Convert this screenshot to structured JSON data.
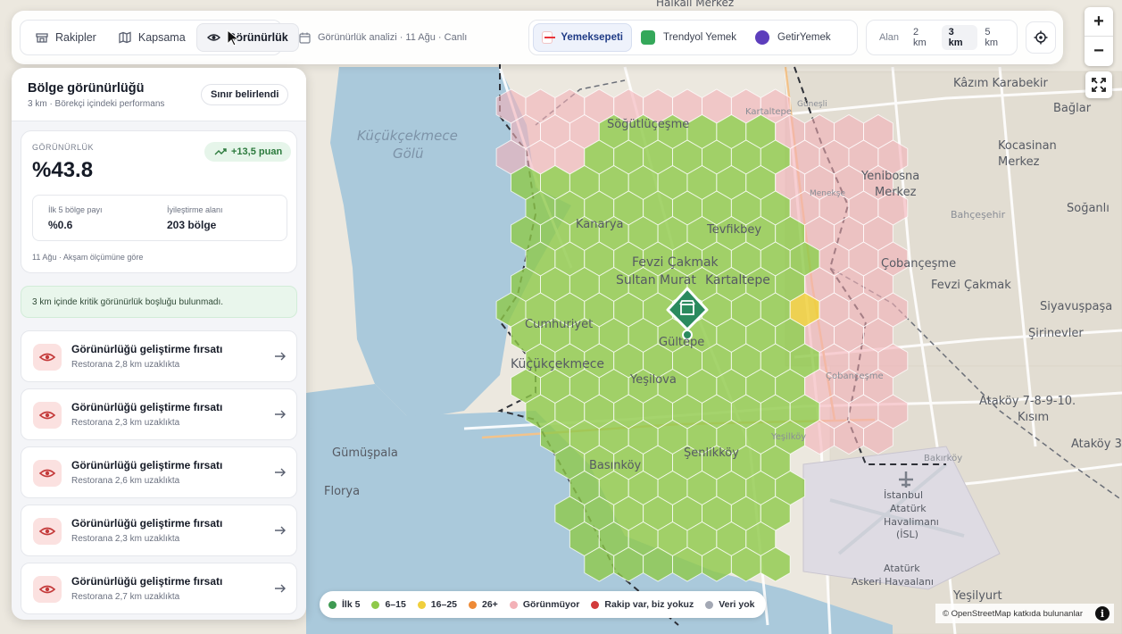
{
  "nav": {
    "tabs": [
      {
        "label": "Rakipler",
        "icon": "store-icon",
        "active": false
      },
      {
        "label": "Kapsama",
        "icon": "map-icon",
        "active": false
      },
      {
        "label": "Görünürlük",
        "icon": "eye-icon",
        "active": true
      }
    ],
    "meta_text": "Görünürlük analizi · 11 Ağu · Canlı",
    "platforms": [
      {
        "label": "Yemeksepeti",
        "color": "#e8353b",
        "active": true
      },
      {
        "label": "Trendyol Yemek",
        "color": "#35a85a",
        "active": false
      },
      {
        "label": "GetirYemek",
        "color": "#5d3ebc",
        "active": false
      }
    ],
    "area_label": "Alan",
    "distances": [
      "2 km",
      "3 km",
      "5 km"
    ],
    "active_distance": "3 km"
  },
  "zoom": {
    "in": "+",
    "out": "−"
  },
  "panel": {
    "title": "Bölge görünürlüğü",
    "subtitle": "3 km · Börekçi içindeki performans",
    "border_button": "Sınır belirlendi",
    "kpi_label": "GÖRÜNÜRLÜK",
    "kpi_value": "%43.8",
    "kpi_delta": "+13,5 puan",
    "stat1_label": "İlk 5 bölge payı",
    "stat1_value": "%0.6",
    "stat2_label": "İyileştirme alanı",
    "stat2_value": "203 bölge",
    "card_footer": "11 Ağu · Akşam ölçümüne göre",
    "notice": "3 km içinde kritik görünürlük boşluğu bulunmadı.",
    "opportunities": [
      {
        "title": "Görünürlüğü geliştirme fırsatı",
        "subtitle": "Restorana 2,8 km uzaklıkta"
      },
      {
        "title": "Görünürlüğü geliştirme fırsatı",
        "subtitle": "Restorana 2,3 km uzaklıkta"
      },
      {
        "title": "Görünürlüğü geliştirme fırsatı",
        "subtitle": "Restorana 2,6 km uzaklıkta"
      },
      {
        "title": "Görünürlüğü geliştirme fırsatı",
        "subtitle": "Restorana 2,3 km uzaklıkta"
      },
      {
        "title": "Görünürlüğü geliştirme fırsatı",
        "subtitle": "Restorana 2,7 km uzaklıkta"
      }
    ]
  },
  "legend": [
    {
      "label": "İlk 5",
      "color": "#3f9a52"
    },
    {
      "label": "6–15",
      "color": "#8fc94a"
    },
    {
      "label": "16–25",
      "color": "#f0cf3c"
    },
    {
      "label": "26+",
      "color": "#ee8a36"
    },
    {
      "label": "Görünmüyor",
      "color": "#f3b1b7"
    },
    {
      "label": "Rakip var, biz yokuz",
      "color": "#d23b3b"
    },
    {
      "label": "Veri yok",
      "color": "#a3a8b4"
    }
  ],
  "attribution": "© OpenStreetMap katkıda bulunanlar",
  "map": {
    "labels": [
      "Halkalı Merkez",
      "Kâzım Karabekir",
      "Bağlar",
      "Kocasinan",
      "Merkez",
      "Yenibosna",
      "Merkez",
      "Bahçeşehir",
      "Soğanlı",
      "Çobançeşme",
      "Fevzi Çakmak",
      "Siyavuşpaşa",
      "Şirinevler",
      "Ataköy 7-8-9-10.",
      "Kısım",
      "Ataköy 3",
      "Bakırköy",
      "Yeşilyurt",
      "İstanbul",
      "Atatürk",
      "Havalimanı",
      "(İSL)",
      "Atatürk",
      "Askeri Havaalanı",
      "Küçükçekmece",
      "Gölü",
      "Söğütlüçeşme",
      "Kanarya",
      "Tevfikbey",
      "Fevzi Çakmak",
      "Sultan Murat",
      "Kartaltepe",
      "Cumhuriyet",
      "Gültepe",
      "Küçükçekmece",
      "Yeşilova",
      "Gümüşpala",
      "Basınköy",
      "Şenlikköy",
      "Yeşilköy",
      "Florya",
      "Güneşli",
      "Çobançeşme",
      "Kartaltepe",
      "Menekşe"
    ]
  }
}
